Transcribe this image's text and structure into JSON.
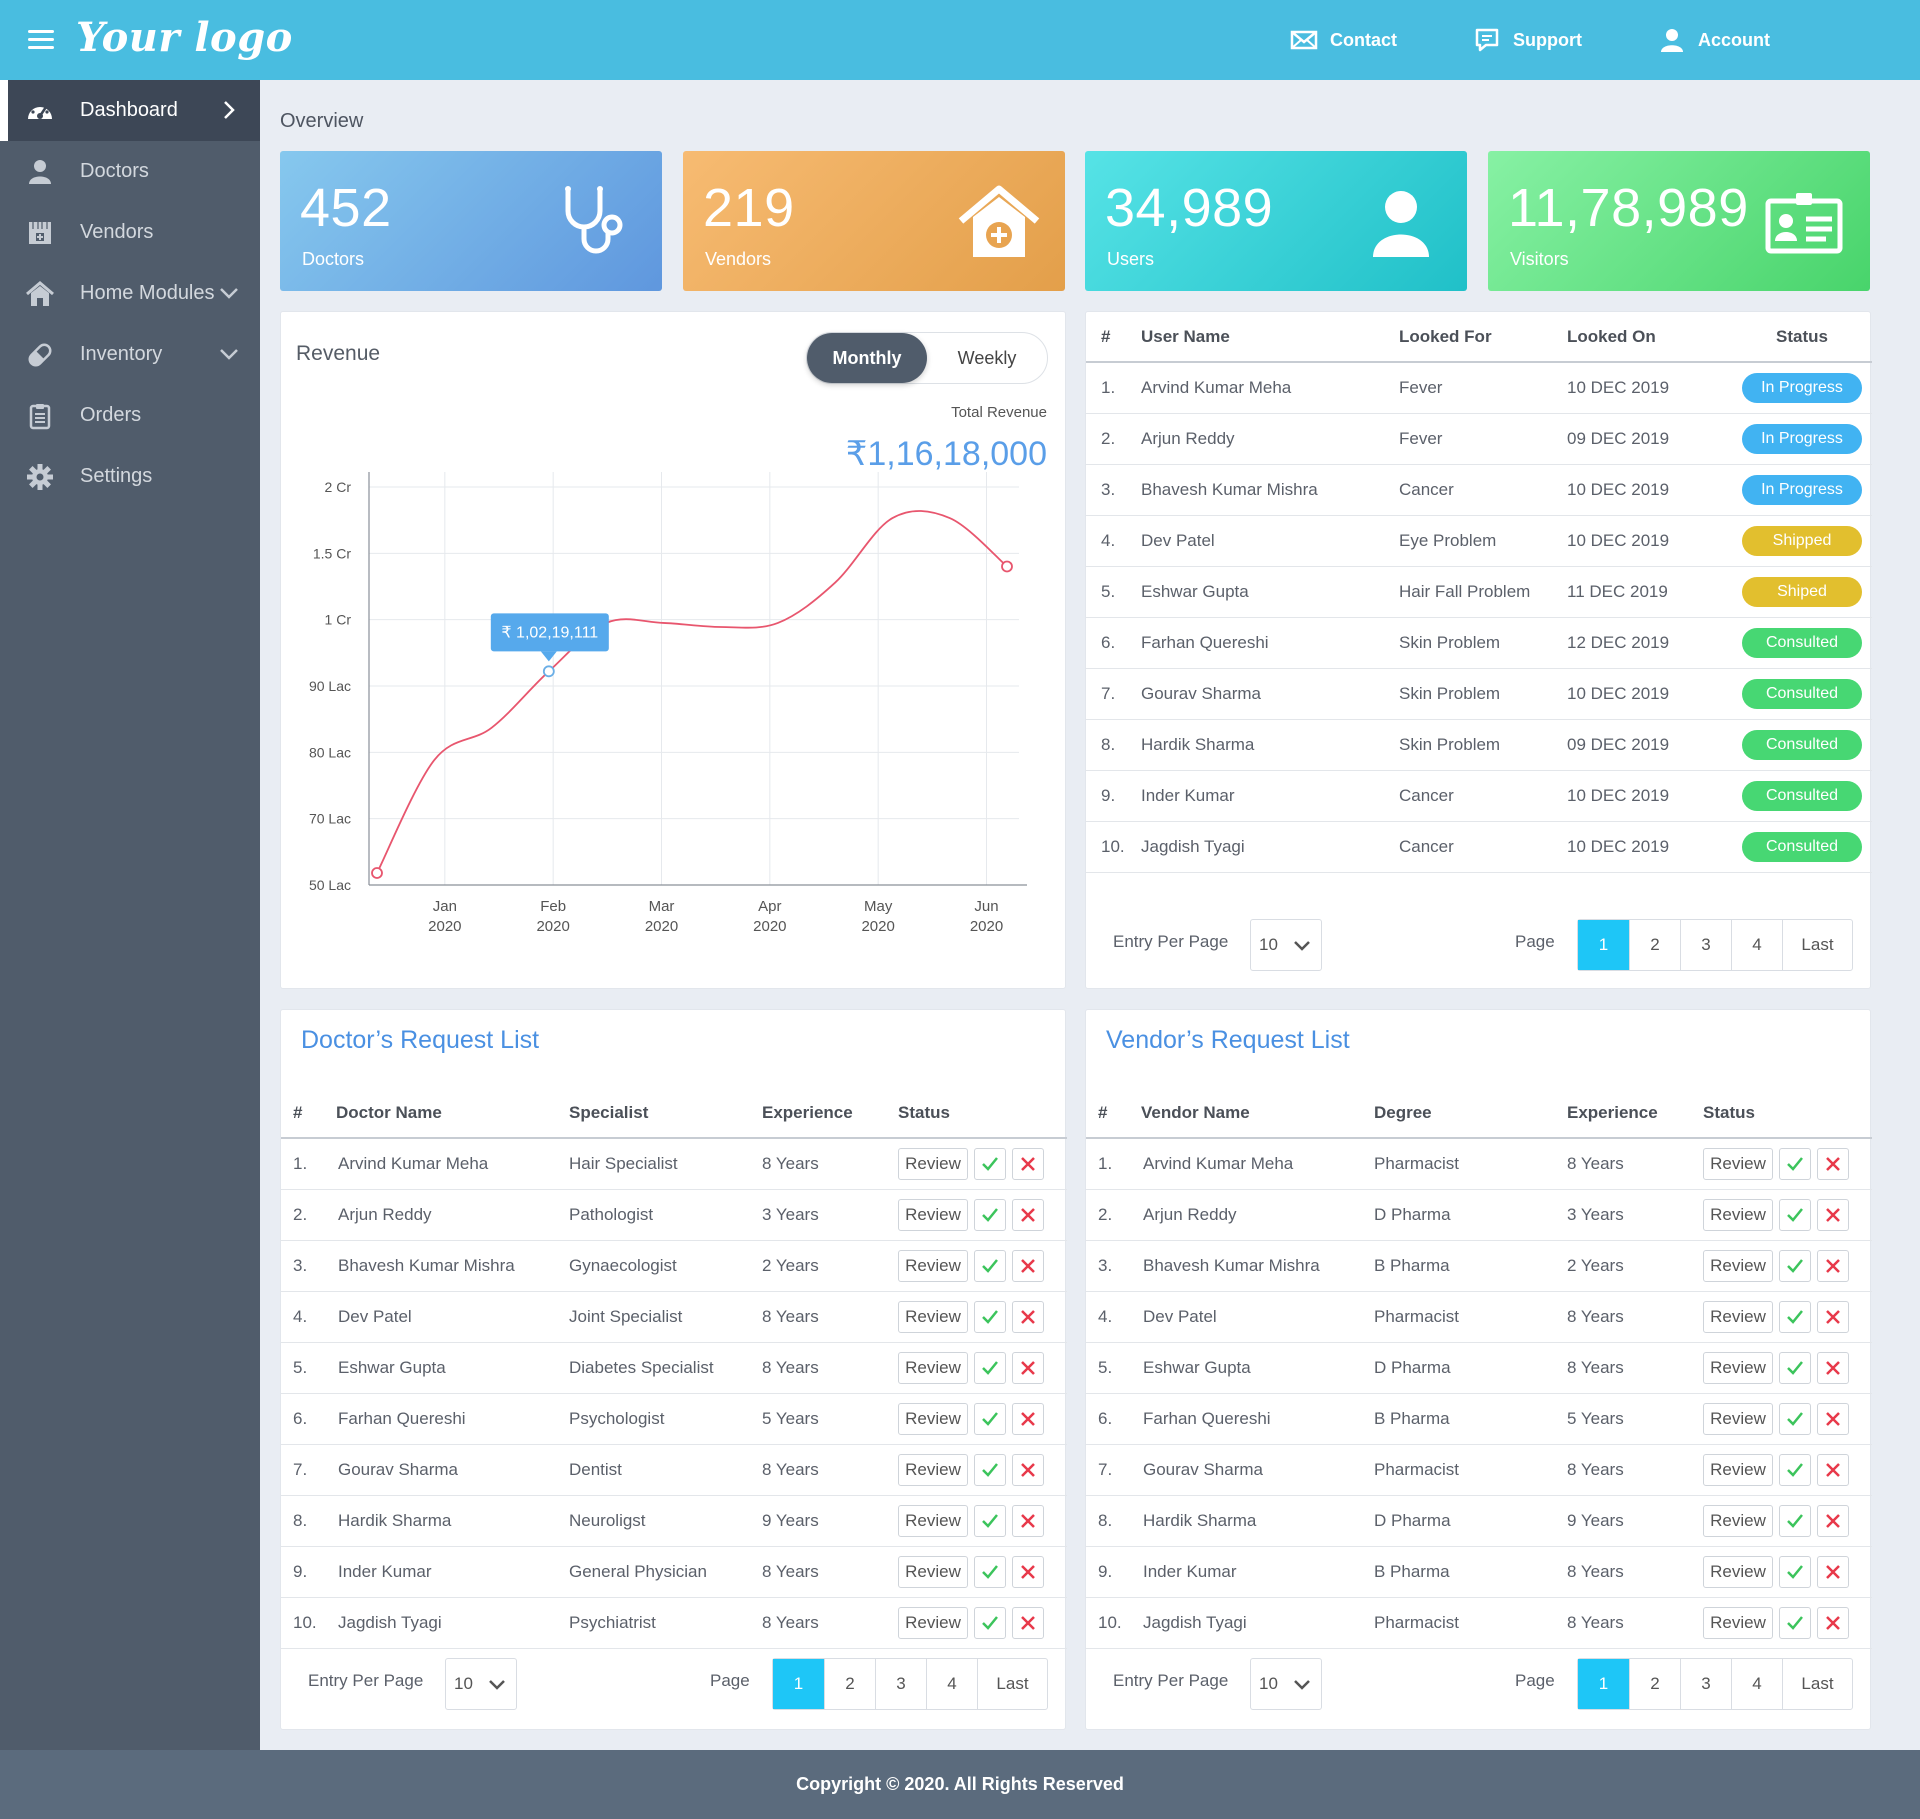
{
  "header": {
    "logo": "Your logo",
    "nav": [
      {
        "label": "Contact",
        "icon": "mail-icon"
      },
      {
        "label": "Support",
        "icon": "chat-icon"
      },
      {
        "label": "Account",
        "icon": "user-icon"
      }
    ]
  },
  "sidebar": {
    "items": [
      {
        "label": "Dashboard",
        "icon": "dashboard-gauge-icon",
        "active": true
      },
      {
        "label": "Doctors",
        "icon": "person-icon"
      },
      {
        "label": "Vendors",
        "icon": "store-icon"
      },
      {
        "label": "Home Modules",
        "icon": "home-icon"
      },
      {
        "label": "Inventory",
        "icon": "pill-icon"
      },
      {
        "label": "Orders",
        "icon": "clipboard-icon"
      },
      {
        "label": "Settings",
        "icon": "gear-icon"
      }
    ]
  },
  "overview": {
    "title": "Overview",
    "cards": [
      {
        "value": "452",
        "label": "Doctors",
        "icon": "stethoscope-icon"
      },
      {
        "value": "219",
        "label": "Vendors",
        "icon": "home-plus-icon"
      },
      {
        "value": "34,989",
        "label": "Users",
        "icon": "user-icon"
      },
      {
        "value": "11,78,989",
        "label": "Visitors",
        "icon": "id-card-icon"
      }
    ]
  },
  "revenue": {
    "title": "Revenue",
    "toggle": {
      "monthly": "Monthly",
      "weekly": "Weekly"
    },
    "total_label": "Total Revenue",
    "total_value": "₹1,16,18,000",
    "tooltip": "₹ 1,02,19,111"
  },
  "chart_data": {
    "type": "line",
    "x": [
      "Jan\n2020",
      "Feb\n2020",
      "Mar\n2020",
      "Apr\n2020",
      "May\n2020",
      "Jun\n2020"
    ],
    "x_tick_labels": [
      [
        "Jan",
        "2020"
      ],
      [
        "Feb",
        "2020"
      ],
      [
        "Mar",
        "2020"
      ],
      [
        "Apr",
        "2020"
      ],
      [
        "May",
        "2020"
      ],
      [
        "Jun",
        "2020"
      ]
    ],
    "y_tick_labels": [
      "2 Cr",
      "1.5 Cr",
      "1 Cr",
      "90 Lac",
      "80 Lac",
      "70 Lac",
      "50 Lac"
    ],
    "series": [
      {
        "values": [
          50,
          78,
          86,
          100,
          112,
          112,
          111,
          112,
          122,
          138,
          138,
          126
        ]
      }
    ],
    "grid": true,
    "color": "#e8566e"
  },
  "recent": {
    "headers": [
      "#",
      "User Name",
      "Looked For",
      "Looked On",
      "Status"
    ],
    "rows": [
      [
        "1.",
        "Arvind Kumar Meha",
        "Fever",
        "10 DEC 2019",
        "In Progress"
      ],
      [
        "2.",
        "Arjun Reddy",
        "Fever",
        "09 DEC 2019",
        "In Progress"
      ],
      [
        "3.",
        "Bhavesh Kumar Mishra",
        "Cancer",
        "10 DEC 2019",
        "In Progress"
      ],
      [
        "4.",
        "Dev Patel",
        "Eye Problem",
        "10 DEC 2019",
        "Shipped"
      ],
      [
        "5.",
        "Eshwar Gupta",
        "Hair Fall Problem",
        "11 DEC 2019",
        "Shiped"
      ],
      [
        "6.",
        "Farhan Quereshi",
        "Skin Problem",
        "12 DEC 2019",
        "Consulted"
      ],
      [
        "7.",
        "Gourav Sharma",
        "Skin Problem",
        "10 DEC 2019",
        "Consulted"
      ],
      [
        "8.",
        "Hardik Sharma",
        "Skin Problem",
        "09 DEC 2019",
        "Consulted"
      ],
      [
        "9.",
        "Inder Kumar",
        "Cancer",
        "10 DEC 2019",
        "Consulted"
      ],
      [
        "10.",
        "Jagdish Tyagi",
        "Cancer",
        "10 DEC 2019",
        "Consulted"
      ]
    ],
    "status_colors": {
      "In Progress": "#41b3f2",
      "Shipped": "#e2bf2e",
      "Shiped": "#e2bf2e",
      "Consulted": "#47d773"
    }
  },
  "pager": {
    "entry_label": "Entry Per Page",
    "entry_value": "10",
    "page_label": "Page",
    "pages": [
      "1",
      "2",
      "3",
      "4"
    ],
    "last": "Last"
  },
  "doctors": {
    "title": "Doctor’s Request List",
    "headers": [
      "#",
      "Doctor Name",
      "Specialist",
      "Experience",
      "Status"
    ],
    "review": "Review",
    "rows": [
      [
        "1.",
        "Arvind Kumar Meha",
        "Hair Specialist",
        "8 Years"
      ],
      [
        "2.",
        "Arjun Reddy",
        "Pathologist",
        "3 Years"
      ],
      [
        "3.",
        "Bhavesh Kumar Mishra",
        "Gynaecologist",
        "2 Years"
      ],
      [
        "4.",
        "Dev Patel",
        "Joint Specialist",
        "8 Years"
      ],
      [
        "5.",
        "Eshwar Gupta",
        "Diabetes Specialist",
        "8 Years"
      ],
      [
        "6.",
        "Farhan Quereshi",
        "Psychologist",
        "5 Years"
      ],
      [
        "7.",
        "Gourav Sharma",
        "Dentist",
        "8 Years"
      ],
      [
        "8.",
        "Hardik Sharma",
        "Neuroligst",
        "9 Years"
      ],
      [
        "9.",
        "Inder Kumar",
        "General Physician",
        "8 Years"
      ],
      [
        "10.",
        "Jagdish Tyagi",
        "Psychiatrist",
        "8 Years"
      ]
    ]
  },
  "vendors": {
    "title": "Vendor’s Request List",
    "headers": [
      "#",
      "Vendor Name",
      "Degree",
      "Experience",
      "Status"
    ],
    "review": "Review",
    "rows": [
      [
        "1.",
        "Arvind Kumar Meha",
        "Pharmacist",
        "8 Years"
      ],
      [
        "2.",
        "Arjun Reddy",
        "D Pharma",
        "3 Years"
      ],
      [
        "3.",
        "Bhavesh Kumar Mishra",
        "B Pharma",
        "2 Years"
      ],
      [
        "4.",
        "Dev Patel",
        "Pharmacist",
        "8 Years"
      ],
      [
        "5.",
        "Eshwar Gupta",
        "D Pharma",
        "8 Years"
      ],
      [
        "6.",
        "Farhan Quereshi",
        "B Pharma",
        "5 Years"
      ],
      [
        "7.",
        "Gourav Sharma",
        "Pharmacist",
        "8 Years"
      ],
      [
        "8.",
        "Hardik Sharma",
        "D Pharma",
        "9 Years"
      ],
      [
        "9.",
        "Inder Kumar",
        "B Pharma",
        "8 Years"
      ],
      [
        "10.",
        "Jagdish Tyagi",
        "Pharmacist",
        "8 Years"
      ]
    ]
  },
  "footer": {
    "text": "Copyright © 2020. All Rights Reserved"
  }
}
